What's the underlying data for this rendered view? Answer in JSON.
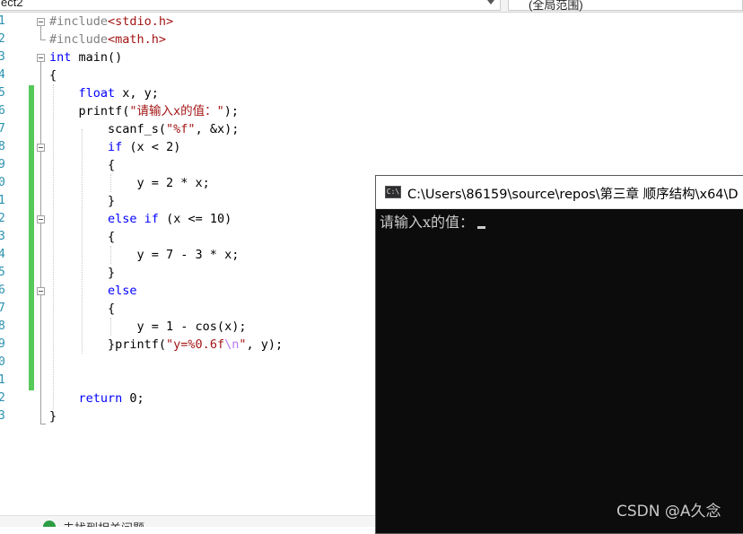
{
  "toolbar": {
    "project_label": "ect2",
    "scope_label": "(全局范围)"
  },
  "editor": {
    "line_numbers": [
      "1",
      "2",
      "3",
      "4",
      "5",
      "6",
      "7",
      "8",
      "9",
      "0",
      "1",
      "2",
      "3",
      "4",
      "5",
      "6",
      "7",
      "8",
      "9",
      "0",
      "1",
      "2",
      "3"
    ],
    "lines": [
      {
        "segments": [
          {
            "t": "#include",
            "c": "pp"
          },
          {
            "t": "<stdio.h>",
            "c": "str"
          }
        ]
      },
      {
        "segments": [
          {
            "t": "#include",
            "c": "pp"
          },
          {
            "t": "<math.h>",
            "c": "str"
          }
        ]
      },
      {
        "segments": [
          {
            "t": "int",
            "c": "kw"
          },
          {
            "t": " main()",
            "c": ""
          }
        ]
      },
      {
        "segments": [
          {
            "t": "{",
            "c": ""
          }
        ]
      },
      {
        "segments": [
          {
            "t": "    ",
            "c": ""
          },
          {
            "t": "float",
            "c": "kw"
          },
          {
            "t": " x, y;",
            "c": ""
          }
        ]
      },
      {
        "segments": [
          {
            "t": "    printf(",
            "c": ""
          },
          {
            "t": "\"请输入x的值：\"",
            "c": "str"
          },
          {
            "t": ");",
            "c": ""
          }
        ]
      },
      {
        "segments": [
          {
            "t": "        scanf_s(",
            "c": ""
          },
          {
            "t": "\"%f\"",
            "c": "str"
          },
          {
            "t": ", &x);",
            "c": ""
          }
        ]
      },
      {
        "segments": [
          {
            "t": "        ",
            "c": ""
          },
          {
            "t": "if",
            "c": "kw"
          },
          {
            "t": " (x < 2)",
            "c": ""
          }
        ]
      },
      {
        "segments": [
          {
            "t": "        {",
            "c": ""
          }
        ]
      },
      {
        "segments": [
          {
            "t": "            y = 2 * x;",
            "c": ""
          }
        ]
      },
      {
        "segments": [
          {
            "t": "        }",
            "c": ""
          }
        ]
      },
      {
        "segments": [
          {
            "t": "        ",
            "c": ""
          },
          {
            "t": "else if",
            "c": "kw"
          },
          {
            "t": " (x <= 10)",
            "c": ""
          }
        ]
      },
      {
        "segments": [
          {
            "t": "        {",
            "c": ""
          }
        ]
      },
      {
        "segments": [
          {
            "t": "            y = 7 - 3 * x;",
            "c": ""
          }
        ]
      },
      {
        "segments": [
          {
            "t": "        }",
            "c": ""
          }
        ]
      },
      {
        "segments": [
          {
            "t": "        ",
            "c": ""
          },
          {
            "t": "else",
            "c": "kw"
          }
        ]
      },
      {
        "segments": [
          {
            "t": "        {",
            "c": ""
          }
        ]
      },
      {
        "segments": [
          {
            "t": "            y = 1 - cos(x);",
            "c": ""
          }
        ]
      },
      {
        "segments": [
          {
            "t": "        }printf(",
            "c": ""
          },
          {
            "t": "\"y=%0.6f",
            "c": "str"
          },
          {
            "t": "\\n",
            "c": "esc"
          },
          {
            "t": "\"",
            "c": "str"
          },
          {
            "t": ", y);",
            "c": ""
          }
        ]
      },
      {
        "segments": []
      },
      {
        "segments": []
      },
      {
        "segments": [
          {
            "t": "    ",
            "c": ""
          },
          {
            "t": "return",
            "c": "kw"
          },
          {
            "t": " 0;",
            "c": ""
          }
        ]
      },
      {
        "segments": [
          {
            "t": "}",
            "c": ""
          }
        ]
      }
    ]
  },
  "console": {
    "icon_text": "C:\\",
    "title": "C:\\Users\\86159\\source\\repos\\第三章 顺序结构\\x64\\D",
    "output": "请输入x的值："
  },
  "watermark": "CSDN @A久念",
  "status": {
    "text": "未找到相关问题"
  }
}
